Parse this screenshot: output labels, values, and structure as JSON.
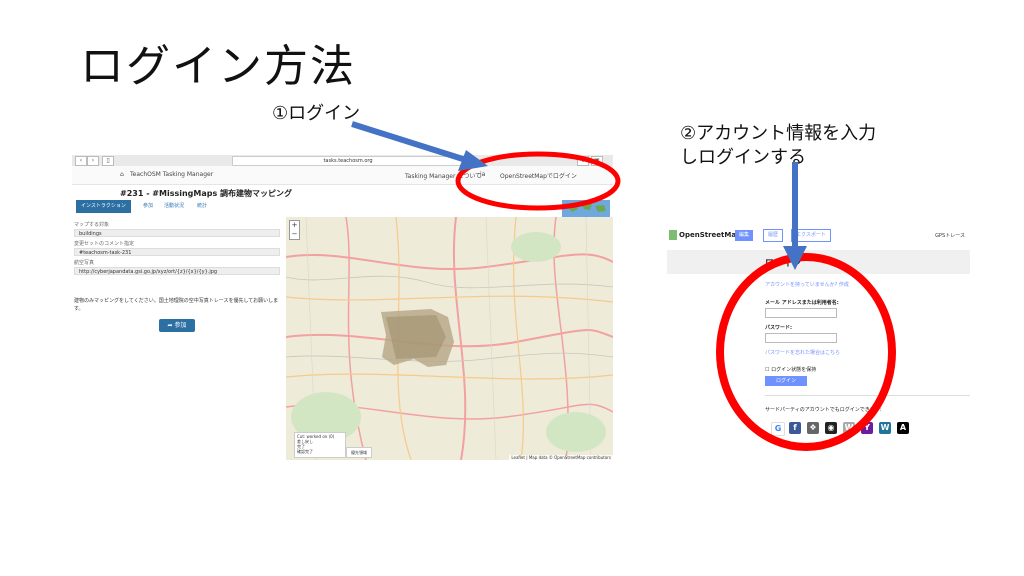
{
  "slide": {
    "title": "ログイン方法",
    "callout1": "①ログイン",
    "callout2_line1": "②アカウント情報を入力",
    "callout2_line2": "しログインする"
  },
  "tasking_manager": {
    "url": "tasks.teachosm.org",
    "app_name": "TeachOSM Tasking Manager",
    "nav_dropdown": "Tasking Manager について",
    "nav_lang": "ja",
    "nav_login": "OpenStreetMapでログイン",
    "project_title": "#231 - #MissingMaps 調布建物マッピング",
    "tabs": [
      "インストラクション",
      "参加",
      "活動状況",
      "統計"
    ],
    "fields": [
      {
        "label": "マップする対象",
        "value": "buildings"
      },
      {
        "label": "変更セットのコメント指定",
        "value": "#teachosm-task-231"
      },
      {
        "label": "航空写真",
        "value": "http://cyberjapandata.gsi.go.jp/xyz/ort/{z}/{x}/{y}.jpg"
      }
    ],
    "description": "建物のみマッピングをしてください。国土地理院の空中写真トレースを優先してお願いします。",
    "join_button": "参加",
    "map_zoom_in": "+",
    "map_zoom_out": "−",
    "legend_items": [
      "Cut: worked on (0)",
      "差し戻し",
      "完了",
      "確認完了"
    ],
    "legend_side": "優先領域",
    "attribution": "Leaflet | Map data © OpenStreetMap contributors"
  },
  "osm": {
    "brand": "OpenStreetMap",
    "edit_btn": "編集",
    "history_btn": "履歴",
    "export_btn": "エクスポート",
    "gps": "GPSトレース",
    "login_title": "ログイン",
    "no_account": "アカウントを持っていませんか? 作成",
    "email_label": "メール アドレスまたは利用者名:",
    "password_label": "パスワード:",
    "forgot": "パスワードを忘れた場合はこちら",
    "remember": "ログイン状態を保持",
    "login_button": "ログイン",
    "third_party": "サードパーティのアカウントでもログインできます:"
  },
  "colors": {
    "arrow": "#4472c4",
    "highlight_ring": "#ff0000",
    "tm_blue": "#2c6fa3",
    "osm_blue": "#7092ff"
  }
}
